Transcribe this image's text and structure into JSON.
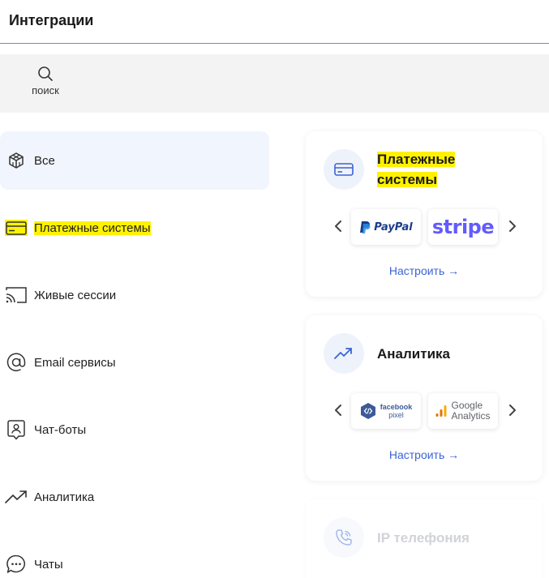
{
  "header": {
    "title": "Интеграции"
  },
  "search": {
    "label": "поиск"
  },
  "sidebar": {
    "items": [
      {
        "label": "Все",
        "icon": "cube-icon"
      },
      {
        "label": "Платежные системы",
        "icon": "credit-card-icon"
      },
      {
        "label": "Живые сессии",
        "icon": "cast-icon"
      },
      {
        "label": "Email сервисы",
        "icon": "at-icon"
      },
      {
        "label": "Чат-боты",
        "icon": "chatbot-icon"
      },
      {
        "label": "Аналитика",
        "icon": "trend-icon"
      },
      {
        "label": "Чаты",
        "icon": "chat-icon"
      }
    ]
  },
  "cards": [
    {
      "title_line1": "Платежные",
      "title_line2": "системы",
      "logos": [
        "PayPal",
        "stripe"
      ],
      "setup": "Настроить →"
    },
    {
      "title": "Аналитика",
      "logos": {
        "fb_line1": "facebook",
        "fb_line2": "pixel",
        "ga_line1": "Google",
        "ga_line2": "Analytics"
      },
      "setup": "Настроить →"
    },
    {
      "title": "IP телефония"
    }
  ],
  "colors": {
    "accent": "#3b63d6",
    "highlight": "#fff200",
    "active_bg": "#f1f5fd"
  }
}
